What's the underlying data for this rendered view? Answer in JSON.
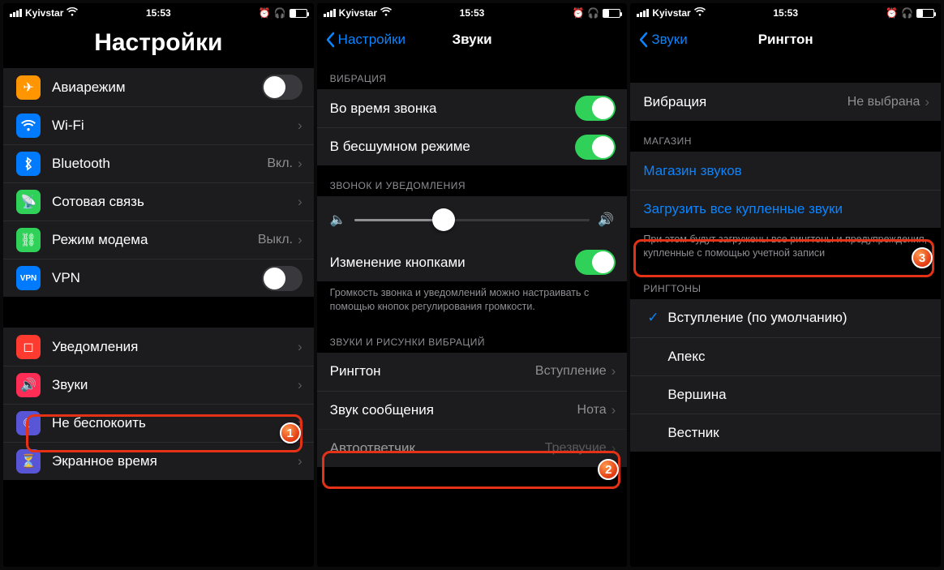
{
  "status": {
    "carrier": "Kyivstar",
    "time": "15:53"
  },
  "s1": {
    "title": "Настройки",
    "airplane": "Авиарежим",
    "wifi": "Wi-Fi",
    "wifi_val": "",
    "bt": "Bluetooth",
    "bt_val": "Вкл.",
    "cell": "Сотовая связь",
    "hotspot": "Режим модема",
    "hotspot_val": "Выкл.",
    "vpn_badge": "VPN",
    "vpn": "VPN",
    "notif": "Уведомления",
    "sounds": "Звуки",
    "dnd": "Не беспокоить",
    "screentime": "Экранное время"
  },
  "s2": {
    "back": "Настройки",
    "title": "Звуки",
    "sec_vibr": "ВИБРАЦИЯ",
    "vibr_ring": "Во время звонка",
    "vibr_silent": "В бесшумном режиме",
    "sec_ring": "ЗВОНОК И УВЕДОМЛЕНИЯ",
    "change_btn": "Изменение кнопками",
    "footer_vol": "Громкость звонка и уведомлений можно настраивать с помощью кнопок регулирования громкости.",
    "sec_patterns": "ЗВУКИ И РИСУНКИ ВИБРАЦИЙ",
    "ringtone": "Рингтон",
    "ringtone_val": "Вступление",
    "texttone": "Звук сообщения",
    "texttone_val": "Нота",
    "voicemail": "Автоответчик",
    "voicemail_val": "Трезвучие"
  },
  "s3": {
    "back": "Звуки",
    "title": "Рингтон",
    "vibration": "Вибрация",
    "vibration_val": "Не выбрана",
    "sec_store": "МАГАЗИН",
    "store": "Магазин звуков",
    "download": "Загрузить все купленные звуки",
    "footer_store": "При этом будут загружены все рингтоны и предупреждения, купленные с помощью учетной записи",
    "sec_ringtones": "РИНГТОНЫ",
    "r1": "Вступление (по умолчанию)",
    "r2": "Апекс",
    "r3": "Вершина",
    "r4": "Вестник"
  },
  "badges": {
    "b1": "1",
    "b2": "2",
    "b3": "3"
  }
}
